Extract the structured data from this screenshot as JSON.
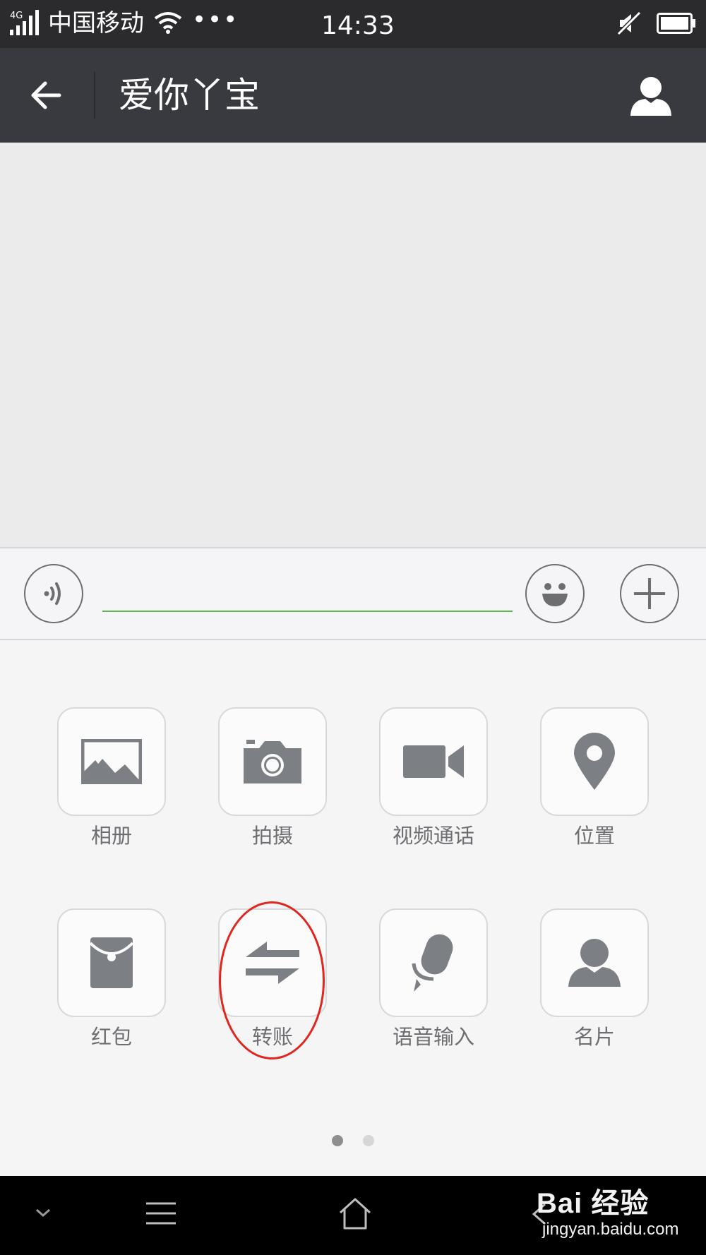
{
  "status_bar": {
    "network": "4G",
    "carrier": "中国移动",
    "more": "•••",
    "time": "14:33"
  },
  "header": {
    "title": "爱你丫宝"
  },
  "input_bar": {
    "text_value": "",
    "accent_color": "#5cb84c"
  },
  "panel": {
    "row1": [
      {
        "label": "相册",
        "icon": "photo-album-icon"
      },
      {
        "label": "拍摄",
        "icon": "camera-icon"
      },
      {
        "label": "视频通话",
        "icon": "video-call-icon"
      },
      {
        "label": "位置",
        "icon": "location-pin-icon"
      }
    ],
    "row2": [
      {
        "label": "红包",
        "icon": "red-envelope-icon"
      },
      {
        "label": "转账",
        "icon": "transfer-icon"
      },
      {
        "label": "语音输入",
        "icon": "microphone-icon"
      },
      {
        "label": "名片",
        "icon": "contact-card-icon"
      }
    ],
    "page_count": 2,
    "current_page": 1
  },
  "annotation": {
    "highlight_color": "#e0261f"
  },
  "watermark": {
    "brand": "Bai 经验",
    "url": "jingyan.baidu.com"
  }
}
